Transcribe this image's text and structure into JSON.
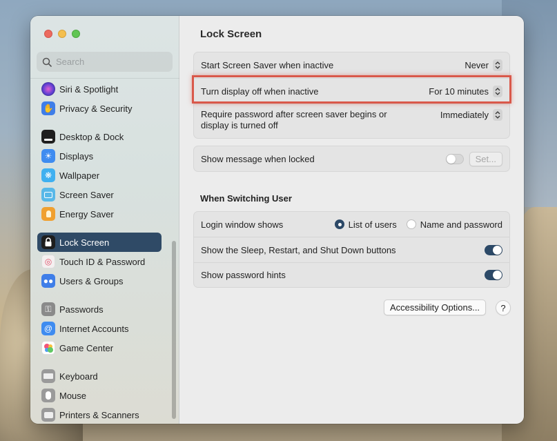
{
  "window": {
    "title": "Lock Screen"
  },
  "search": {
    "placeholder": "Search"
  },
  "sidebar": {
    "items": [
      {
        "label": "Siri & Spotlight",
        "icon": "siri-icon",
        "color": "#6a3fb0"
      },
      {
        "label": "Privacy & Security",
        "icon": "hand-icon",
        "color": "#3f7ee8"
      },
      {
        "label": "Desktop & Dock",
        "icon": "dock-icon",
        "color": "#1e1e1e"
      },
      {
        "label": "Displays",
        "icon": "display-icon",
        "color": "#3f8cf0"
      },
      {
        "label": "Wallpaper",
        "icon": "wallpaper-icon",
        "color": "#3fb0f0"
      },
      {
        "label": "Screen Saver",
        "icon": "screensaver-icon",
        "color": "#58b8e8"
      },
      {
        "label": "Energy Saver",
        "icon": "energy-icon",
        "color": "#f0a030"
      },
      {
        "label": "Lock Screen",
        "icon": "lock-icon",
        "color": "#1e1e1e"
      },
      {
        "label": "Touch ID & Password",
        "icon": "fingerprint-icon",
        "color": "#f4f0f0"
      },
      {
        "label": "Users & Groups",
        "icon": "users-icon",
        "color": "#3f7ee8"
      },
      {
        "label": "Passwords",
        "icon": "key-icon",
        "color": "#8a8a8a"
      },
      {
        "label": "Internet Accounts",
        "icon": "at-icon",
        "color": "#3f8cf0"
      },
      {
        "label": "Game Center",
        "icon": "gamecenter-icon",
        "color": "#ffffff"
      },
      {
        "label": "Keyboard",
        "icon": "keyboard-icon",
        "color": "#9a9a9a"
      },
      {
        "label": "Mouse",
        "icon": "mouse-icon",
        "color": "#9a9a9a"
      },
      {
        "label": "Printers & Scanners",
        "icon": "printer-icon",
        "color": "#9a9a9a"
      }
    ]
  },
  "settings": {
    "screen_saver": {
      "label": "Start Screen Saver when inactive",
      "value": "Never"
    },
    "display_off": {
      "label": "Turn display off when inactive",
      "value": "For 10 minutes"
    },
    "require_password": {
      "label": "Require password after screen saver begins or display is turned off",
      "value": "Immediately"
    },
    "show_message": {
      "label": "Show message when locked",
      "toggle": false,
      "button": "Set..."
    }
  },
  "switching": {
    "title": "When Switching User",
    "login_window": {
      "label": "Login window shows",
      "options": [
        "List of users",
        "Name and password"
      ],
      "selected": "List of users"
    },
    "sleep_buttons": {
      "label": "Show the Sleep, Restart, and Shut Down buttons",
      "toggle": true
    },
    "password_hints": {
      "label": "Show password hints",
      "toggle": true
    }
  },
  "footer": {
    "accessibility_button": "Accessibility Options...",
    "help": "?"
  },
  "colors": {
    "accent": "#2c4967",
    "highlight": "#d9584a"
  }
}
